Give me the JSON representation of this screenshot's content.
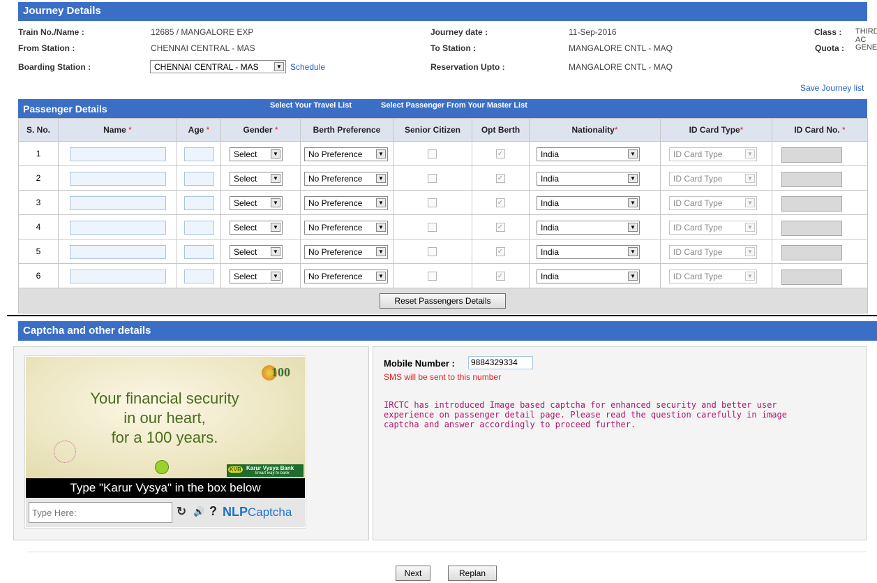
{
  "journey": {
    "title": "Journey Details",
    "train_label": "Train No./Name :",
    "train_value": "12685 / MANGALORE EXP",
    "from_label": "From Station :",
    "from_value": "CHENNAI CENTRAL - MAS",
    "boarding_label": "Boarding Station :",
    "boarding_value": "CHENNAI CENTRAL - MAS",
    "schedule_link": "Schedule",
    "date_label": "Journey date :",
    "date_value": "11-Sep-2016",
    "to_label": "To Station :",
    "to_value": "MANGALORE CNTL - MAQ",
    "upto_label": "Reservation Upto :",
    "upto_value": "MANGALORE CNTL - MAQ",
    "class_label": "Class :",
    "class_value": "THIRD AC",
    "quota_label": "Quota :",
    "quota_value": "GENERAL",
    "save_list": "Save Journey list"
  },
  "passengers": {
    "title": "Passenger Details",
    "travel_list": "Select Your Travel List",
    "master_list": "Select Passenger From Your Master List",
    "columns": [
      "S. No.",
      "Name",
      "Age",
      "Gender",
      "Berth Preference",
      "Senior Citizen",
      "Opt Berth",
      "Nationality",
      "ID Card Type",
      "ID Card No."
    ],
    "required_mark": "*",
    "gender_default": "Select",
    "berth_default": "No Preference",
    "nationality_default": "India",
    "idtype_default": "ID Card Type",
    "rows": [
      "1",
      "2",
      "3",
      "4",
      "5",
      "6"
    ],
    "reset_button": "Reset Passengers Details"
  },
  "captcha": {
    "title": "Captcha and other details",
    "ad_line1": "Your financial security",
    "ad_line2": "in our heart,",
    "ad_line3": "for a 100 years.",
    "bank_name": "Karur Vysya Bank",
    "bank_tag": "Smart way to bank",
    "bank_logo": "KVB",
    "anniv": "100",
    "instruction": "Type \"Karur Vysya\" in the box below",
    "input_placeholder": "Type Here:",
    "brand_nlp": "NLP",
    "brand_captcha": "Captcha",
    "mobile_label": "Mobile Number :",
    "mobile_value": "9884329334",
    "sms_note": "SMS will be sent to this number",
    "info_text": "IRCTC has introduced Image based captcha for enhanced security and better user experience on passenger detail page. Please read the question carefully in image captcha and answer accordingly to proceed further."
  },
  "footer": {
    "next_button": "Next",
    "replan_button": "Replan"
  },
  "colors": {
    "header_blue": "#3b6fc6",
    "table_header_bg": "#dde4f0",
    "sms_red": "#e02020",
    "info_magenta": "#b0156d"
  }
}
